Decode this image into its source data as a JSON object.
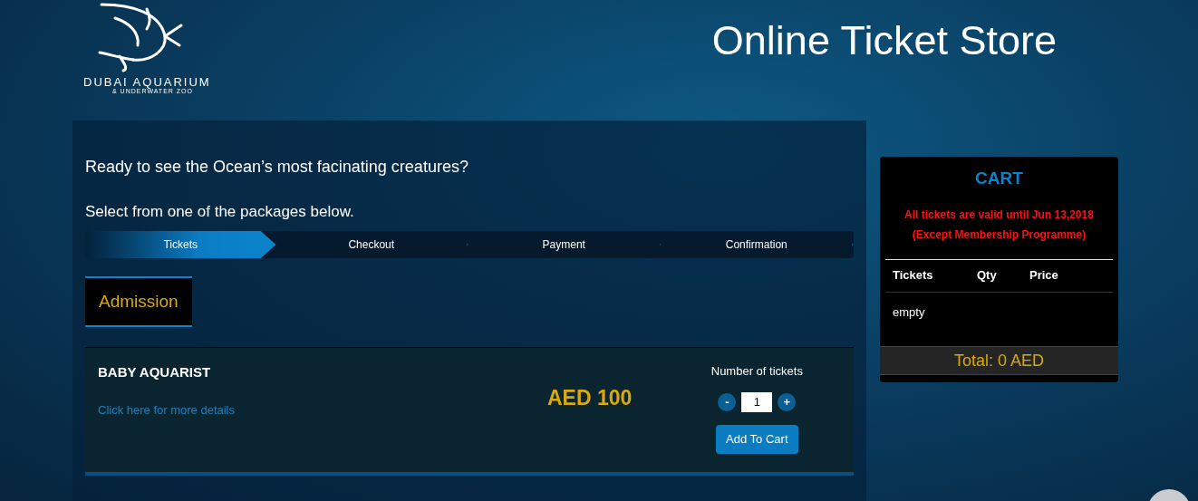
{
  "header": {
    "logo": {
      "name": "DUBAI AQUARIUM",
      "tagline": "& UNDERWATER ZOO"
    },
    "title": "Online Ticket Store"
  },
  "intro": [
    "Ready to see the Ocean’s most facinating creatures?",
    "Select from one of the packages below."
  ],
  "steps": [
    {
      "label": "Tickets",
      "selected": true
    },
    {
      "label": "Checkout",
      "selected": false
    },
    {
      "label": "Payment",
      "selected": false
    },
    {
      "label": "Confirmation",
      "selected": false
    }
  ],
  "category_tabs": [
    {
      "label": "Admission",
      "selected": true
    }
  ],
  "packages": [
    {
      "name": "BABY AQUARIST",
      "details_link": "Click here for more details",
      "price": "AED 100",
      "quantity_label": "Number of tickets",
      "quantity": "1",
      "decrement": "-",
      "increment": "+",
      "add_button": "Add To Cart"
    }
  ],
  "cart": {
    "title": "CART",
    "notice_lines": [
      "All tickets are valid until Jun 13,2018",
      "(Except Membership Programme)"
    ],
    "columns": [
      "Tickets",
      "Qty",
      "Price"
    ],
    "empty_text": "empty",
    "total": "Total: 0 AED"
  }
}
